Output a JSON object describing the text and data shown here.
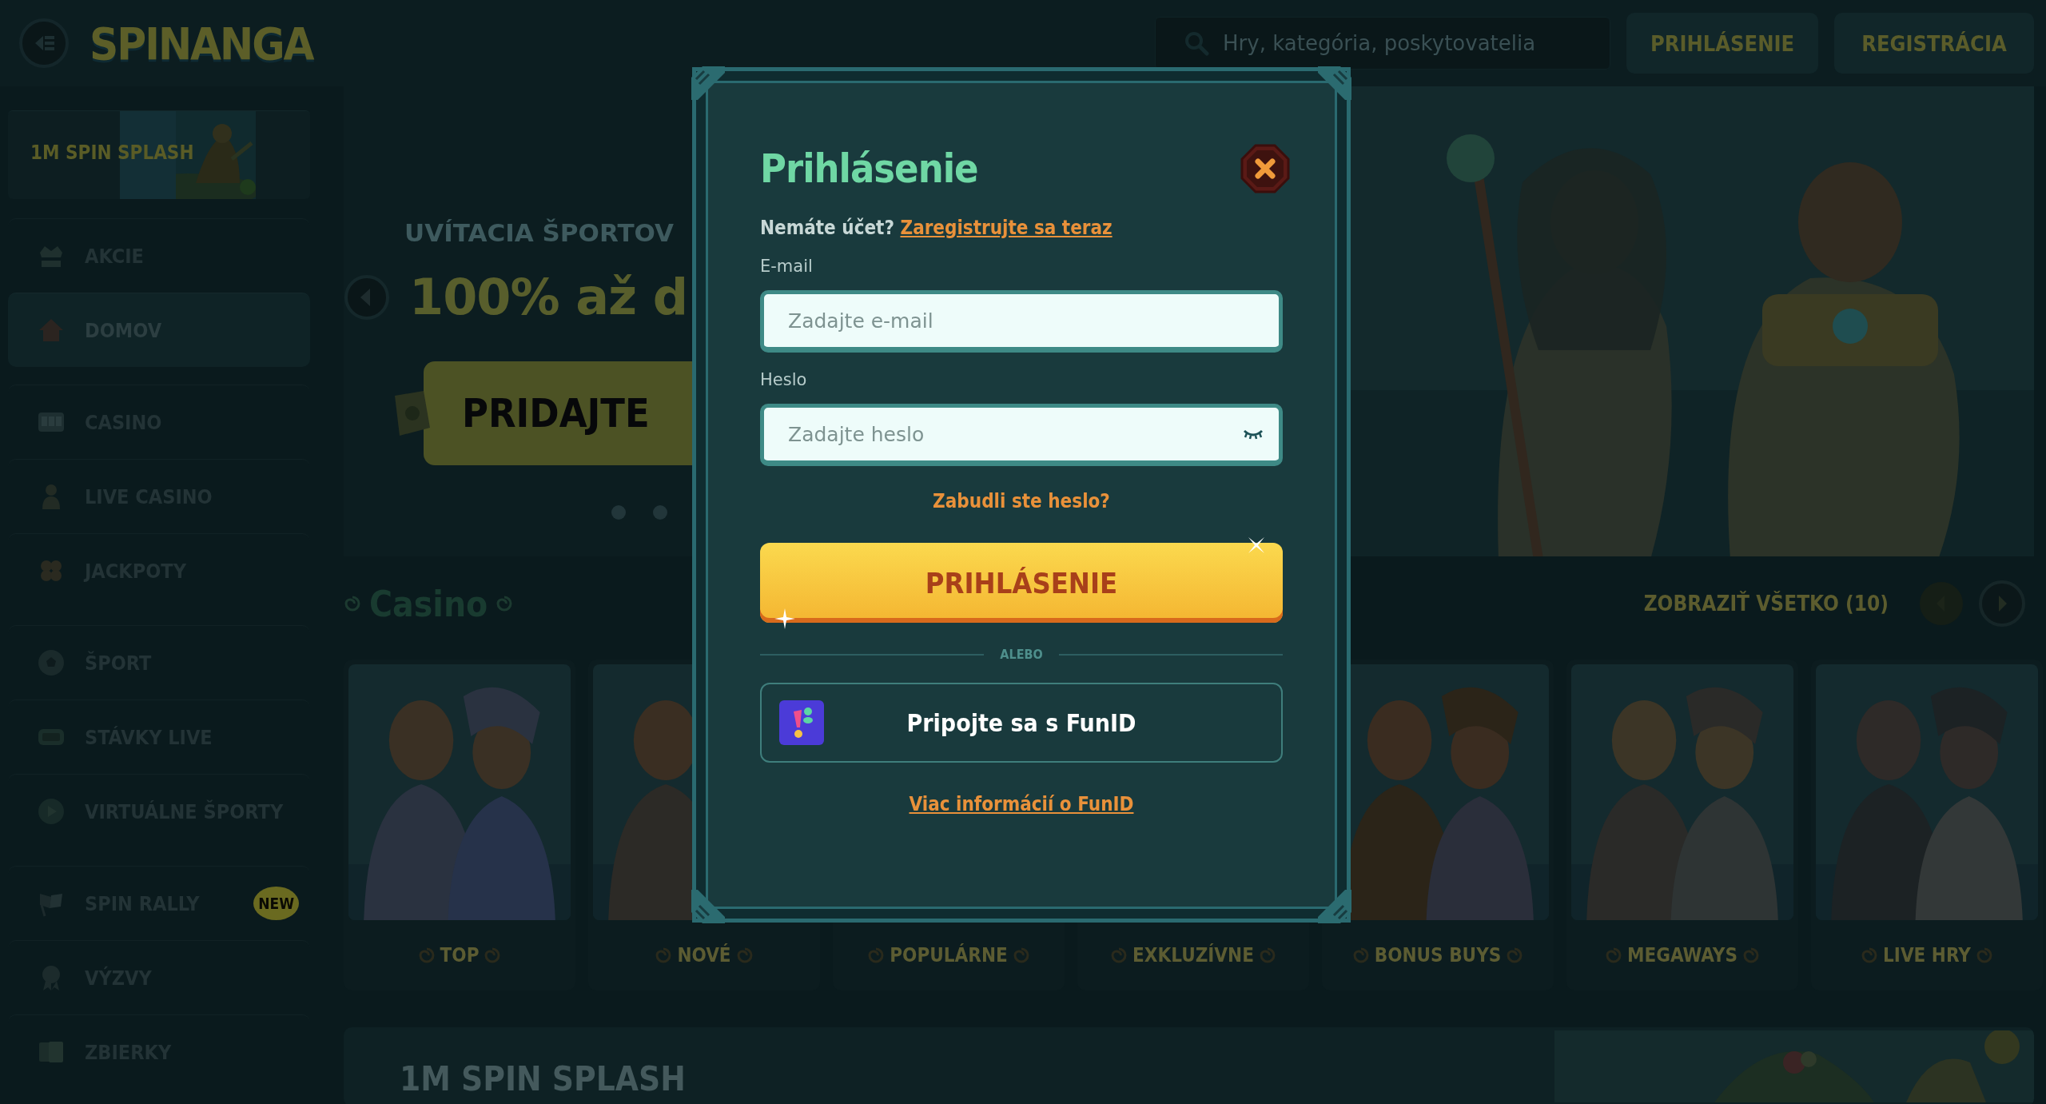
{
  "header": {
    "logo": "SPINANGA",
    "search": {
      "placeholder": "Hry, kategória, poskytovatelia"
    },
    "buttons": [
      {
        "label": "PRIHLÁSENIE",
        "kind": "login"
      },
      {
        "label": "REGISTRÁCIA",
        "kind": "register"
      }
    ]
  },
  "sidebar": {
    "banner": {
      "title": "1M SPIN SPLASH"
    },
    "groups": [
      {
        "items": [
          {
            "label": "AKCIE",
            "selected": false
          },
          {
            "label": "DOMOV",
            "selected": true
          }
        ]
      },
      {
        "items": [
          {
            "label": "CASINO",
            "selected": false
          },
          {
            "label": "LIVE CASINO",
            "selected": false
          },
          {
            "label": "JACKPOTY",
            "selected": false
          }
        ]
      },
      {
        "items": [
          {
            "label": "ŠPORT",
            "selected": false
          },
          {
            "label": "STÁVKY LIVE",
            "selected": false
          },
          {
            "label": "VIRTUÁLNE ŠPORTY",
            "selected": false
          }
        ]
      },
      {
        "items": [
          {
            "label": "SPIN RALLY",
            "selected": false,
            "badge": "NEW"
          },
          {
            "label": "VÝZVY",
            "selected": false
          },
          {
            "label": "ZBIERKY",
            "selected": false
          }
        ]
      }
    ]
  },
  "hero": {
    "subtitle": "UVÍTACIA ŠPORTOV",
    "headline": "100% až d",
    "button": "PRIDAJTE",
    "dots": [
      {
        "selected": false
      },
      {
        "selected": false
      }
    ]
  },
  "casino": {
    "title": "Casino",
    "view_all": "ZOBRAZIŤ VŠETKO (10)",
    "tiles": [
      {
        "label": "TOP"
      },
      {
        "label": "NOVÉ"
      },
      {
        "label": "POPULÁRNE"
      },
      {
        "label": "EXKLUZÍVNE"
      },
      {
        "label": "BONUS BUYS"
      },
      {
        "label": "MEGAWAYS"
      },
      {
        "label": "LIVE HRY"
      }
    ]
  },
  "promo": {
    "title": "1M SPIN SPLASH"
  },
  "login_dialog": {
    "title": "Prihlásenie",
    "prompt": "Nemáte účet?",
    "register_link": "Zaregistrujte sa teraz",
    "fields": [
      {
        "label": "E-mail",
        "placeholder": "Zadajte e-mail",
        "kind": "email"
      },
      {
        "label": "Heslo",
        "placeholder": "Zadajte heslo",
        "kind": "password"
      }
    ],
    "forgot_link": "Zabudli ste heslo?",
    "submit": "PRIHLÁSENIE",
    "divider": "ALEBO",
    "funid_button": "Pripojte sa s FunID",
    "funid_link": "Viac informácií o FunID"
  }
}
